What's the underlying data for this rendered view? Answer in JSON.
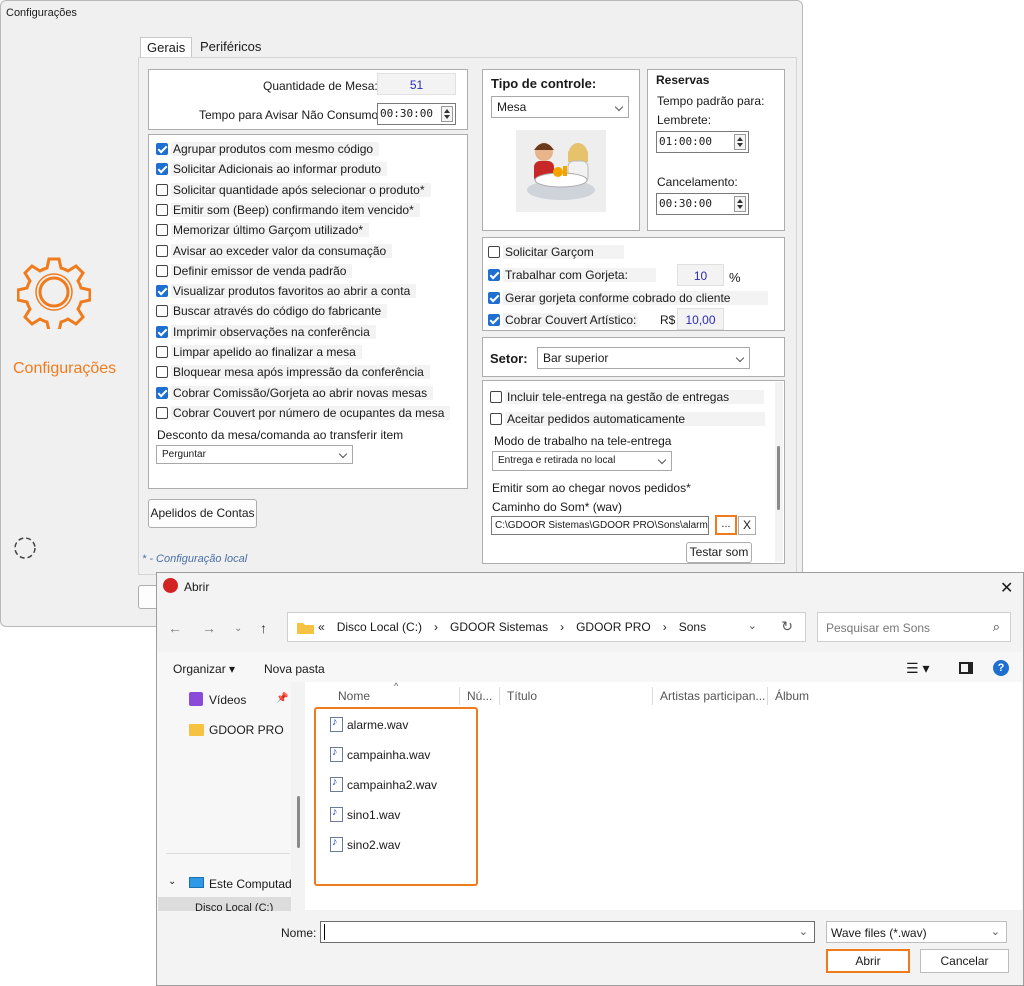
{
  "config": {
    "window_title": "Configurações",
    "sidebar_label": "Configurações",
    "tabs": [
      "Gerais",
      "Periféricos"
    ],
    "quantidade_label": "Quantidade de Mesa:",
    "quantidade_value": "51",
    "tempo_label": "Tempo para Avisar Não Consumo",
    "tempo_value": "00:30:00",
    "options": [
      {
        "label": "Agrupar produtos com mesmo código",
        "checked": true
      },
      {
        "label": "Solicitar Adicionais ao informar produto",
        "checked": true
      },
      {
        "label": "Solicitar quantidade após selecionar o produto*",
        "checked": false
      },
      {
        "label": "Emitir som (Beep) confirmando item vencido*",
        "checked": false
      },
      {
        "label": "Memorizar último Garçom utilizado*",
        "checked": false
      },
      {
        "label": "Avisar ao exceder valor da consumação",
        "checked": false
      },
      {
        "label": "Definir emissor de venda padrão",
        "checked": false
      },
      {
        "label": "Visualizar produtos favoritos ao abrir a conta",
        "checked": true
      },
      {
        "label": "Buscar através do código do fabricante",
        "checked": false
      },
      {
        "label": "Imprimir observações na conferência",
        "checked": true
      },
      {
        "label": "Limpar apelido ao finalizar a mesa",
        "checked": false
      },
      {
        "label": "Bloquear mesa após impressão da conferência",
        "checked": false
      },
      {
        "label": "Cobrar Comissão/Gorjeta ao abrir novas mesas",
        "checked": true
      },
      {
        "label": "Cobrar Couvert por número de ocupantes da mesa",
        "checked": false
      }
    ],
    "desconto_label": "Desconto da mesa/comanda ao transferir item",
    "desconto_value": "Perguntar",
    "apelidos_button": "Apelidos de Contas",
    "footnote": "* - Configuração local",
    "tipo_label": "Tipo de controle:",
    "tipo_value": "Mesa",
    "reservas_label": "Reservas",
    "reservas_tempo": "Tempo padrão para:",
    "lembrete_label": "Lembrete:",
    "lembrete_value": "01:00:00",
    "cancelamento_label": "Cancelamento:",
    "cancelamento_value": "00:30:00",
    "solicitar_garcom": "Solicitar Garçom",
    "trabalhar_gorjeta": "Trabalhar com Gorjeta:",
    "gorjeta_value": "10",
    "percent": "%",
    "gerar_gorjeta": "Gerar gorjeta conforme cobrado do cliente",
    "cobrar_couvert": "Cobrar Couvert Artístico:",
    "currency": "R$",
    "couvert_value": "10,00",
    "setor_label": "Setor:",
    "setor_value": "Bar superior",
    "incluir_tele": "Incluir tele-entrega na gestão de entregas",
    "aceitar_pedidos": "Aceitar pedidos automaticamente",
    "modo_label": "Modo de trabalho na tele-entrega",
    "modo_value": "Entrega e retirada no local",
    "emitir_som": "Emitir som ao chegar novos pedidos*",
    "caminho_label": "Caminho do Som* (wav)",
    "caminho_value": "C:\\GDOOR Sistemas\\GDOOR PRO\\Sons\\alarme.",
    "browse_button": "...",
    "clear_button": "X",
    "testar_button": "Testar som"
  },
  "dialog": {
    "title": "Abrir",
    "breadcrumb": [
      "«",
      "Disco Local (C:)",
      "GDOOR Sistemas",
      "GDOOR PRO",
      "Sons"
    ],
    "search_placeholder": "Pesquisar em Sons",
    "organizar": "Organizar",
    "nova_pasta": "Nova pasta",
    "nav_items": [
      "Vídeos",
      "GDOOR PRO",
      "Este Computador",
      "Disco Local (C:)"
    ],
    "columns": [
      "Nome",
      "Nú...",
      "Título",
      "Artistas participan...",
      "Álbum"
    ],
    "files": [
      "alarme.wav",
      "campainha.wav",
      "campainha2.wav",
      "sino1.wav",
      "sino2.wav"
    ],
    "name_label": "Nome:",
    "name_value": "",
    "filetype_value": "Wave files (*.wav)",
    "open_button": "Abrir",
    "cancel_button": "Cancelar"
  },
  "colors": {
    "accent": "#f07b1d",
    "checkbox": "#1f6fd1",
    "value_text": "#2b2bb6"
  }
}
